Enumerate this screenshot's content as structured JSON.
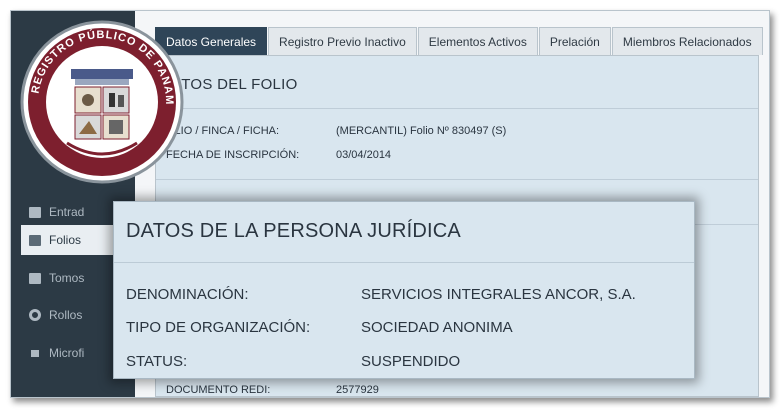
{
  "sidebar": {
    "items": [
      {
        "label": "Entrad",
        "icon": "folder-icon"
      },
      {
        "label": "Folios",
        "icon": "file-icon"
      },
      {
        "label": "Tomos",
        "icon": "book-icon"
      },
      {
        "label": "Rollos",
        "icon": "life-ring-icon"
      },
      {
        "label": "Microfi",
        "icon": "film-icon"
      }
    ]
  },
  "tabs": [
    {
      "label": "Datos Generales",
      "active": true
    },
    {
      "label": "Registro Previo Inactivo"
    },
    {
      "label": "Elementos Activos"
    },
    {
      "label": "Prelación"
    },
    {
      "label": "Miembros Relacionados"
    }
  ],
  "folio": {
    "title": "ATOS DEL FOLIO",
    "rows": [
      {
        "label": "OLIO / FINCA / FICHA:",
        "value": "(MERCANTIL) Folio Nº 830497 (S)"
      },
      {
        "label": "FECHA DE INSCRIPCIÓN:",
        "value": "03/04/2014"
      }
    ],
    "bottom_rows": [
      {
        "label": "DOCUMENTO REDI:",
        "value": "2577929"
      }
    ]
  },
  "seal": {
    "text": "REGISTRO PÚBLICO DE PANAMÁ"
  },
  "persona": {
    "title": "DATOS DE LA PERSONA JURÍDICA",
    "rows": [
      {
        "label": "DENOMINACIÓN:",
        "value": "SERVICIOS INTEGRALES ANCOR, S.A."
      },
      {
        "label": "TIPO DE ORGANIZACIÓN:",
        "value": "SOCIEDAD ANONIMA"
      },
      {
        "label": "STATUS:",
        "value": "SUSPENDIDO"
      }
    ]
  },
  "colors": {
    "sidebar": "#2c3a45",
    "active_tab": "#2f4558",
    "panel": "#d9e6ef",
    "seal_ring": "#7d1f2e"
  }
}
